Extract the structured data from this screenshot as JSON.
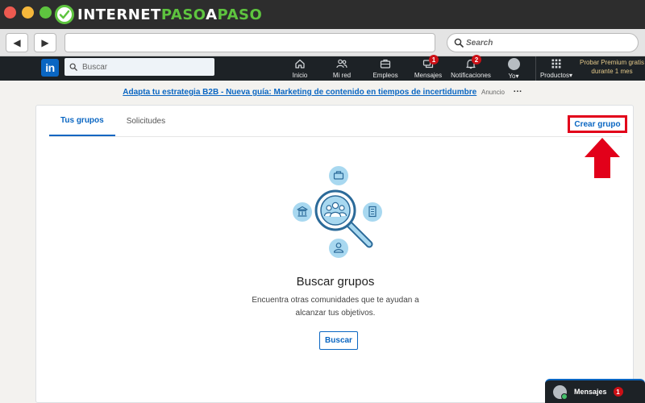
{
  "browser": {
    "brand_part1": "INTERNET",
    "brand_part2": "PASO",
    "brand_part3": "A",
    "brand_part4": "PASO",
    "search_placeholder": "Search",
    "back_icon": "◀",
    "forward_icon": "▶"
  },
  "header": {
    "logo": "in",
    "search_placeholder": "Buscar",
    "nav": [
      {
        "label": "Inicio",
        "icon": "home-icon"
      },
      {
        "label": "Mi red",
        "icon": "people-icon"
      },
      {
        "label": "Empleos",
        "icon": "briefcase-icon"
      },
      {
        "label": "Mensajes",
        "icon": "chat-icon",
        "badge": "1"
      },
      {
        "label": "Notificaciones",
        "icon": "bell-icon",
        "badge": "2"
      },
      {
        "label": "Yo▾",
        "icon": "avatar"
      },
      {
        "label": "Productos▾",
        "icon": "grid-icon"
      }
    ],
    "premium": "Probar Premium gratis durante 1 mes"
  },
  "ad": {
    "link_text": "Adapta tu estrategia B2B - Nueva guía: Marketing de contenido en tiempos de incertidumbre",
    "tag": "Anuncio",
    "more": "···"
  },
  "groups": {
    "tabs": [
      "Tus grupos",
      "Solicitudes"
    ],
    "create_label": "Crear grupo",
    "empty_title": "Buscar grupos",
    "empty_desc": "Encuentra otras comunidades que te ayudan a alcanzar tus objetivos.",
    "search_button": "Buscar"
  },
  "messaging": {
    "label": "Mensajes",
    "badge": "1"
  },
  "colors": {
    "linkedin_blue": "#0a66c2",
    "header_bg": "#1d2226",
    "highlight_red": "#e2001a",
    "badge_red": "#cc1016",
    "illustration_blue": "#a8d8f0"
  }
}
